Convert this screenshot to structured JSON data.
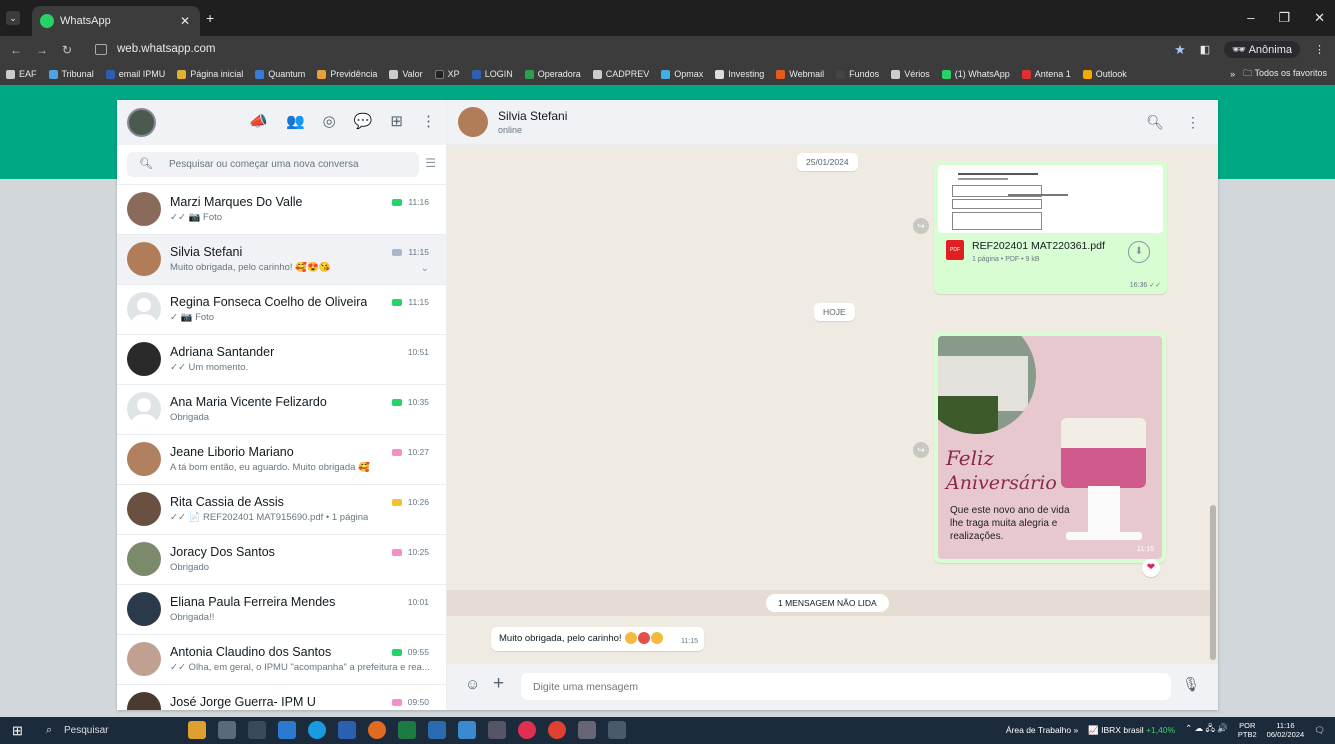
{
  "browser": {
    "tab_title": "WhatsApp",
    "url": "web.whatsapp.com",
    "incognito_label": "Anônima",
    "bookmarks": [
      "EAF",
      "Tribunal",
      "email IPMU",
      "Página inicial",
      "Quantum",
      "Previdência",
      "Valor",
      "XP",
      "LOGIN",
      "Operadora",
      "CADPREV",
      "Opmax",
      "Investing",
      "Webmail",
      "Fundos",
      "Vérios",
      "(1) WhatsApp",
      "Antena 1",
      "Outlook"
    ],
    "all_favorites_label": "Todos os favoritos"
  },
  "sidebar": {
    "search_placeholder": "Pesquisar ou começar uma nova conversa",
    "chats": [
      {
        "name": "Marzi Marques Do Valle",
        "preview": "✓✓ 📷 Foto",
        "time": "11:16",
        "tag_color": "#25d366"
      },
      {
        "name": "Silvia Stefani",
        "preview": "Muito obrigada, pelo carinho! 🥰😍😘",
        "time": "11:15",
        "tag_color": "#a9b9c8"
      },
      {
        "name": "Regina Fonseca Coelho de Oliveira",
        "preview": "✓ 📷 Foto",
        "time": "11:15",
        "tag_color": "#25d366"
      },
      {
        "name": "Adriana Santander",
        "preview": "✓✓ Um momento.",
        "time": "10:51",
        "tag_color": ""
      },
      {
        "name": "Ana Maria Vicente Felizardo",
        "preview": "Obrigada",
        "time": "10:35",
        "tag_color": "#25d366"
      },
      {
        "name": "Jeane Liborio Mariano",
        "preview": "A tá bom então, eu aguardo. Muito obrigada 🥰",
        "time": "10:27",
        "tag_color": "#f48fc8"
      },
      {
        "name": "Rita Cassia de Assis",
        "preview": "✓✓ 📄 REF202401 MAT915690.pdf • 1 página",
        "time": "10:26",
        "tag_color": "#f2c236"
      },
      {
        "name": "Joracy Dos Santos",
        "preview": "Obrigado",
        "time": "10:25",
        "tag_color": "#f48fc8"
      },
      {
        "name": "Eliana Paula Ferreira Mendes",
        "preview": "Obrigada!!",
        "time": "10:01",
        "tag_color": ""
      },
      {
        "name": "Antonia Claudino dos Santos",
        "preview": "✓✓ Olha, em geral, o IPMU \"acompanha\" a prefeitura e rea...",
        "time": "09:55",
        "tag_color": "#25d366"
      },
      {
        "name": "José Jorge Guerra- IPM U",
        "preview": "✓✓ Então o melhor agora é aguardar o reajuste sair e entr...",
        "time": "09:50",
        "tag_color": "#f48fc8"
      }
    ]
  },
  "conversation": {
    "contact_name": "Silvia Stefani",
    "contact_status": "online",
    "date_pill_1": "25/01/2024",
    "document": {
      "name": "REF202401 MAT220361.pdf",
      "meta": "1 página • PDF • 9 kB",
      "time": "16:36 ✓✓"
    },
    "date_pill_2": "HOJE",
    "card": {
      "title1": "Feliz",
      "title2": "Aniversário",
      "text": "Que este novo ano de vida lhe traga muita alegria e realizações.",
      "time": "11:15"
    },
    "reaction": "❤",
    "unread_label": "1 MENSAGEM NÃO LIDA",
    "incoming_text": "Muito obrigada, pelo carinho!",
    "incoming_time": "11:15",
    "input_placeholder": "Digite uma mensagem"
  },
  "taskbar": {
    "search_label": "Pesquisar",
    "desktop_label": "Área de Trabalho",
    "stock_label": "IBRX brasil",
    "stock_change": "+1,40%",
    "lang1": "POR",
    "lang2": "PTB2",
    "time": "11:16",
    "date": "06/02/2024"
  }
}
